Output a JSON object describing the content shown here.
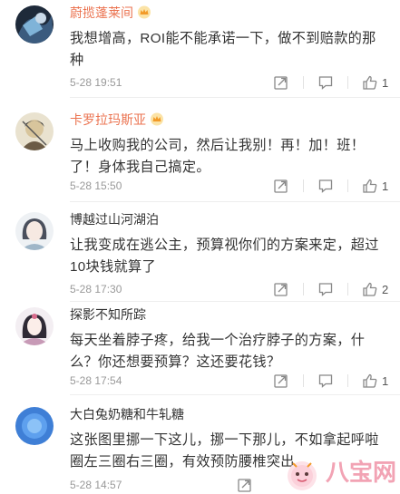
{
  "comments": [
    {
      "username": "蔚揽蓬莱间",
      "text": "我想增高，ROI能不能承诺一下，做不到赔款的那种",
      "time": "5-28 19:51",
      "likes": "1",
      "vip": true
    },
    {
      "username": "卡罗拉玛斯亚",
      "text": "马上收购我的公司，然后让我别！再！加！班！了！身体我自己搞定。",
      "time": "5-28 15:50",
      "likes": "1",
      "vip": true
    },
    {
      "username": "博越过山河湖泊",
      "text": "让我变成在逃公主，预算视你们的方案来定，超过10块钱就算了",
      "time": "5-28 17:30",
      "likes": "2",
      "vip": false
    },
    {
      "username": "探影不知所踪",
      "text": "每天坐着脖子疼，给我一个治疗脖子的方案，什么？你还想要预算？这还要花钱？",
      "time": "5-28 17:54",
      "likes": "1",
      "vip": false
    },
    {
      "username": "大白兔奶糖和牛轧糖",
      "text": "这张图里挪一下这儿，挪一下那儿，不如拿起呼啦圈左三圈右三圈，有效预防腰椎突出",
      "time": "5-28 14:57",
      "likes": "",
      "vip": false
    }
  ],
  "icons": {
    "repost": "repost-icon",
    "comment": "comment-icon",
    "like": "thumbs-up-icon",
    "crown": "crown-icon"
  },
  "colors": {
    "vip_name": "#eb7350",
    "text": "#333333",
    "meta": "#999999",
    "divider": "#eeeeee",
    "watermark": "#f2a3b4"
  },
  "watermark": {
    "text": "八宝网"
  }
}
